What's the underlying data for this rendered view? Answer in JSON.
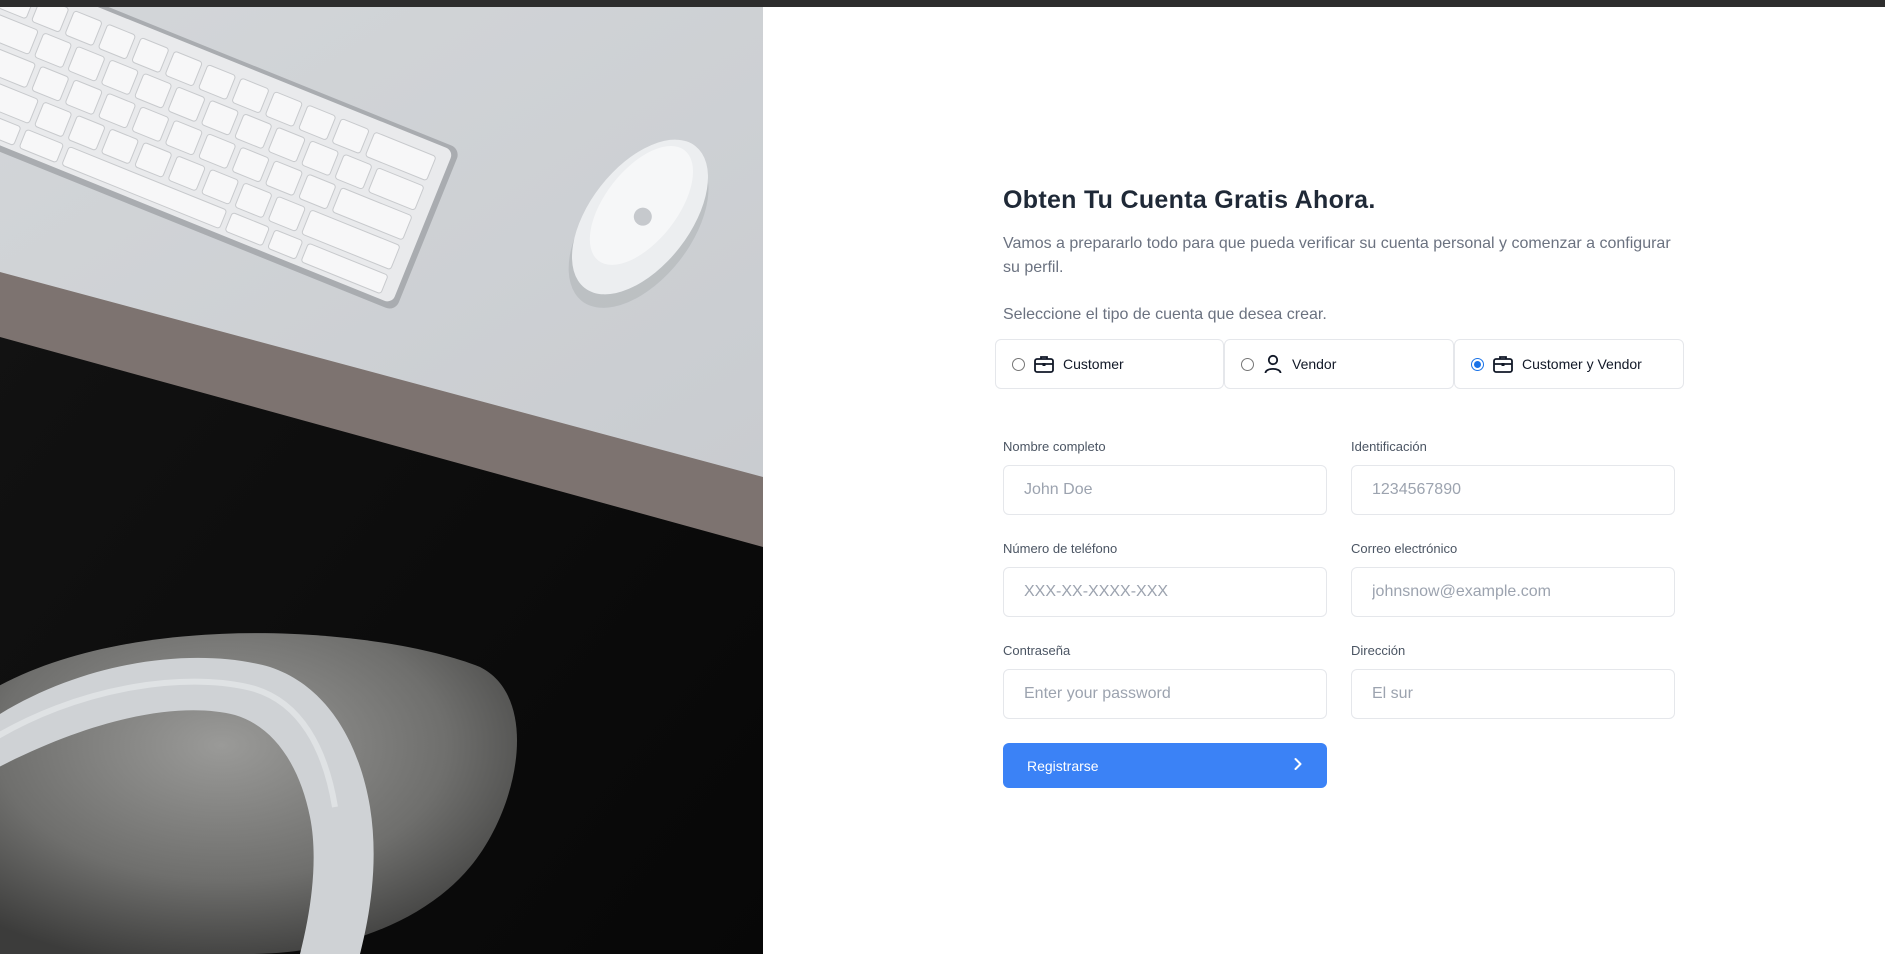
{
  "page": {
    "title": "Obten Tu Cuenta Gratis Ahora.",
    "intro": "Vamos a prepararlo todo para que pueda verificar su cuenta personal y comenzar a configurar su perfil.",
    "account_prompt": "Seleccione el tipo de cuenta que desea crear."
  },
  "account_types": [
    {
      "label": "Customer",
      "icon": "briefcase-icon",
      "selected": false
    },
    {
      "label": "Vendor",
      "icon": "user-icon",
      "selected": false
    },
    {
      "label": "Customer y Vendor",
      "icon": "briefcase-icon",
      "selected": true
    }
  ],
  "form": {
    "full_name": {
      "label": "Nombre completo",
      "placeholder": "John Doe",
      "value": ""
    },
    "identification": {
      "label": "Identificación",
      "placeholder": "1234567890",
      "value": ""
    },
    "phone": {
      "label": "Número de teléfono",
      "placeholder": "XXX-XX-XXXX-XXX",
      "value": ""
    },
    "email": {
      "label": "Correo electrónico",
      "placeholder": "johnsnow@example.com",
      "value": ""
    },
    "password": {
      "label": "Contraseña",
      "placeholder": "Enter your password",
      "value": ""
    },
    "address": {
      "label": "Dirección",
      "placeholder": "El sur",
      "value": ""
    },
    "submit_label": "Registrarse"
  },
  "colors": {
    "accent": "#3b82f6",
    "radio_checked": "#1a73e8",
    "heading": "#1f2937",
    "muted_text": "#6b7280",
    "border": "#e5e7eb"
  },
  "hero_image": {
    "subject": "desk-with-keyboard-mouse-and-chair"
  }
}
